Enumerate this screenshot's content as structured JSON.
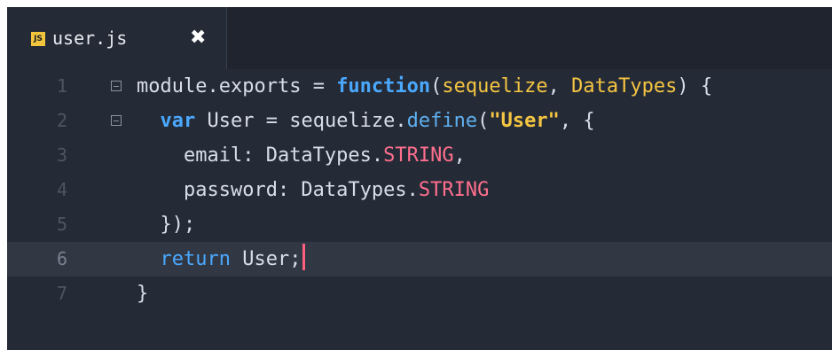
{
  "tab": {
    "icon_label": "JS",
    "title": "user.js",
    "close_label": "✖"
  },
  "code": {
    "lines": [
      {
        "number": "1",
        "foldable": true
      },
      {
        "number": "2",
        "foldable": true
      },
      {
        "number": "3",
        "foldable": false
      },
      {
        "number": "4",
        "foldable": false
      },
      {
        "number": "5",
        "foldable": false
      },
      {
        "number": "6",
        "foldable": false,
        "active": true
      },
      {
        "number": "7",
        "foldable": false
      }
    ],
    "tokens": {
      "l1_module": "module",
      "l1_dot": ".",
      "l1_exports": "exports = ",
      "l1_function": "function",
      "l1_paren_open": "(",
      "l1_param1": "sequelize",
      "l1_comma": ", ",
      "l1_param2": "DataTypes",
      "l1_paren_close": ") {",
      "l2_var": "var",
      "l2_assign": " User = sequelize.",
      "l2_define": "define",
      "l2_paren": "(",
      "l2_string": "\"User\"",
      "l2_rest": ", {",
      "l3_key": "email: DataTypes.",
      "l3_const": "STRING",
      "l3_comma": ",",
      "l4_key": "password: DataTypes.",
      "l4_const": "STRING",
      "l5_text": "});",
      "l6_return": "return",
      "l6_rest": " User;",
      "l7_text": "}"
    }
  },
  "colors": {
    "editor_bg": "#252b36",
    "active_line": "#313844",
    "keyword": "#4aa8ff",
    "string": "#f5c542",
    "constant": "#ff6f8e",
    "cursor": "#ff5e7e"
  }
}
